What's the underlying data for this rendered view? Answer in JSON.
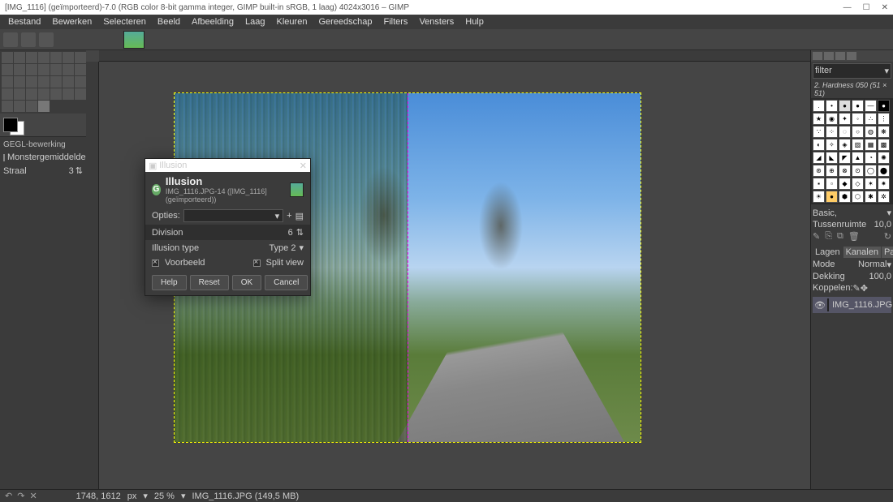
{
  "titlebar": {
    "text": "[IMG_1116] (geïmporteerd)-7.0 (RGB color 8-bit gamma integer, GIMP built-in sRGB, 1 laag) 4024x3016 – GIMP"
  },
  "menu": [
    "Bestand",
    "Bewerken",
    "Selecteren",
    "Beeld",
    "Afbeelding",
    "Laag",
    "Kleuren",
    "Gereedschap",
    "Filters",
    "Vensters",
    "Hulp"
  ],
  "toolopts": {
    "header": "GEGL-bewerking",
    "checkbox": "Monstergemiddelde",
    "radius_label": "Straal",
    "radius_value": "3"
  },
  "dialog": {
    "wintitle": "Illusion",
    "title": "Illusion",
    "subtitle": "IMG_1116.JPG-14 ([IMG_1116] (geïmporteerd))",
    "options_label": "Opties:",
    "division_label": "Division",
    "division_value": "6",
    "type_label": "Illusion type",
    "type_value": "Type 2",
    "preview_label": "Voorbeeld",
    "split_label": "Split view",
    "buttons": {
      "help": "Help",
      "reset": "Reset",
      "ok": "OK",
      "cancel": "Cancel"
    }
  },
  "brushes": {
    "filter_placeholder": "filter",
    "selected": "2. Hardness 050 (51 × 51)",
    "preset_label": "Basic,",
    "spacing_label": "Tussenruimte",
    "spacing_value": "10,0"
  },
  "layers": {
    "tabs": [
      "Lagen",
      "Kanalen",
      "Paden"
    ],
    "mode_label": "Mode",
    "mode_value": "Normal",
    "opacity_label": "Dekking",
    "opacity_value": "100,0",
    "lock_label": "Koppelen:",
    "item": "IMG_1116.JPG"
  },
  "status": {
    "coords": "1748, 1612",
    "unit": "px",
    "zoom": "25 %",
    "file": "IMG_1116.JPG (149,5 MB)"
  }
}
